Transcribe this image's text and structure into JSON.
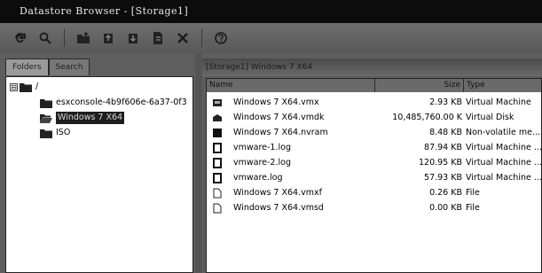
{
  "window": {
    "title": "Datastore Browser - [Storage1]"
  },
  "toolbar": {
    "buttons": [
      {
        "icon": "refresh-icon"
      },
      {
        "icon": "search-icon"
      },
      {
        "icon": "new-folder-icon"
      },
      {
        "icon": "upload-icon"
      },
      {
        "icon": "download-icon"
      },
      {
        "icon": "copy-icon"
      },
      {
        "icon": "delete-icon"
      },
      {
        "icon": "help-icon"
      }
    ]
  },
  "left": {
    "tabs": [
      {
        "label": "Folders"
      },
      {
        "label": "Search"
      }
    ],
    "tree": {
      "root": {
        "expander": "⊟",
        "label": "/"
      },
      "items": [
        {
          "label": "esxconsole-4b9f606e-6a37-0f3"
        },
        {
          "label": "Windows 7 X64"
        },
        {
          "label": "ISO"
        }
      ]
    }
  },
  "right": {
    "path": "[Storage1] Windows 7 X64",
    "columns": {
      "name": "Name",
      "size": "Size",
      "type": "Type"
    },
    "files": [
      {
        "icon": "vm-config-icon",
        "name": "Windows 7 X64.vmx",
        "size": "2.93 KB",
        "type": "Virtual Machine"
      },
      {
        "icon": "virtual-disk-icon",
        "name": "Windows 7 X64.vmdk",
        "size": "10,485,760.00 K",
        "type": "Virtual Disk"
      },
      {
        "icon": "nvram-icon",
        "name": "Windows 7 X64.nvram",
        "size": "8.48 KB",
        "type": "Non-volatile me..."
      },
      {
        "icon": "log-file-icon",
        "name": "vmware-1.log",
        "size": "87.94 KB",
        "type": "Virtual Machine ..."
      },
      {
        "icon": "log-file-icon",
        "name": "vmware-2.log",
        "size": "120.95 KB",
        "type": "Virtual Machine ..."
      },
      {
        "icon": "log-file-icon",
        "name": "vmware.log",
        "size": "57.93 KB",
        "type": "Virtual Machine ..."
      },
      {
        "icon": "file-icon",
        "name": "Windows 7 X64.vmxf",
        "size": "0.26 KB",
        "type": "File"
      },
      {
        "icon": "file-icon",
        "name": "Windows 7 X64.vmsd",
        "size": "0.00 KB",
        "type": "File"
      }
    ]
  }
}
